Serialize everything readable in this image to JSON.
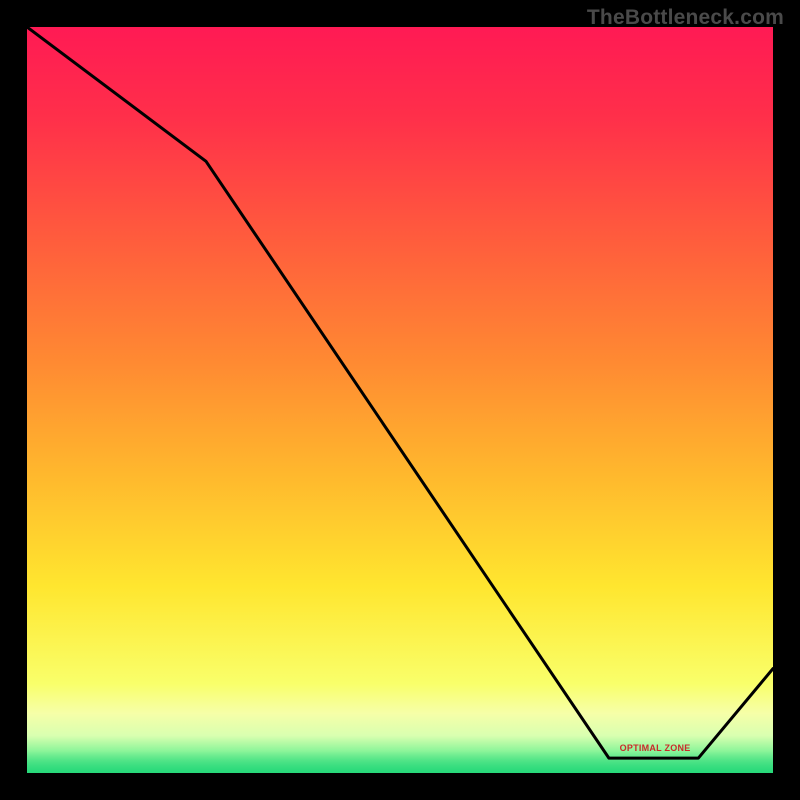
{
  "watermark": "TheBottleneck.com",
  "optimal_label": "OPTIMAL ZONE",
  "chart_data": {
    "type": "line",
    "title": "",
    "xlabel": "",
    "ylabel": "",
    "xlim": [
      0,
      100
    ],
    "ylim": [
      0,
      100
    ],
    "x": [
      0,
      24,
      78,
      90,
      100
    ],
    "values": [
      100,
      82,
      2,
      2,
      14
    ],
    "optimal_zone": {
      "y_min": 0,
      "y_max": 3
    },
    "optimal_segment": {
      "x_start": 78,
      "x_end": 90
    },
    "gradient_stops": [
      {
        "pct": 0,
        "color": "#ff1a54"
      },
      {
        "pct": 12,
        "color": "#ff2f4a"
      },
      {
        "pct": 28,
        "color": "#ff5b3d"
      },
      {
        "pct": 45,
        "color": "#ff8a32"
      },
      {
        "pct": 60,
        "color": "#ffb82d"
      },
      {
        "pct": 75,
        "color": "#ffe62f"
      },
      {
        "pct": 88,
        "color": "#f9ff6a"
      },
      {
        "pct": 92,
        "color": "#f6ffa8"
      },
      {
        "pct": 95,
        "color": "#d9ffb0"
      },
      {
        "pct": 97,
        "color": "#8ef59a"
      },
      {
        "pct": 100,
        "color": "#27d97a"
      }
    ]
  },
  "colors": {
    "line": "#000000",
    "label": "#c92a2a",
    "watermark": "#4a4a4a"
  }
}
